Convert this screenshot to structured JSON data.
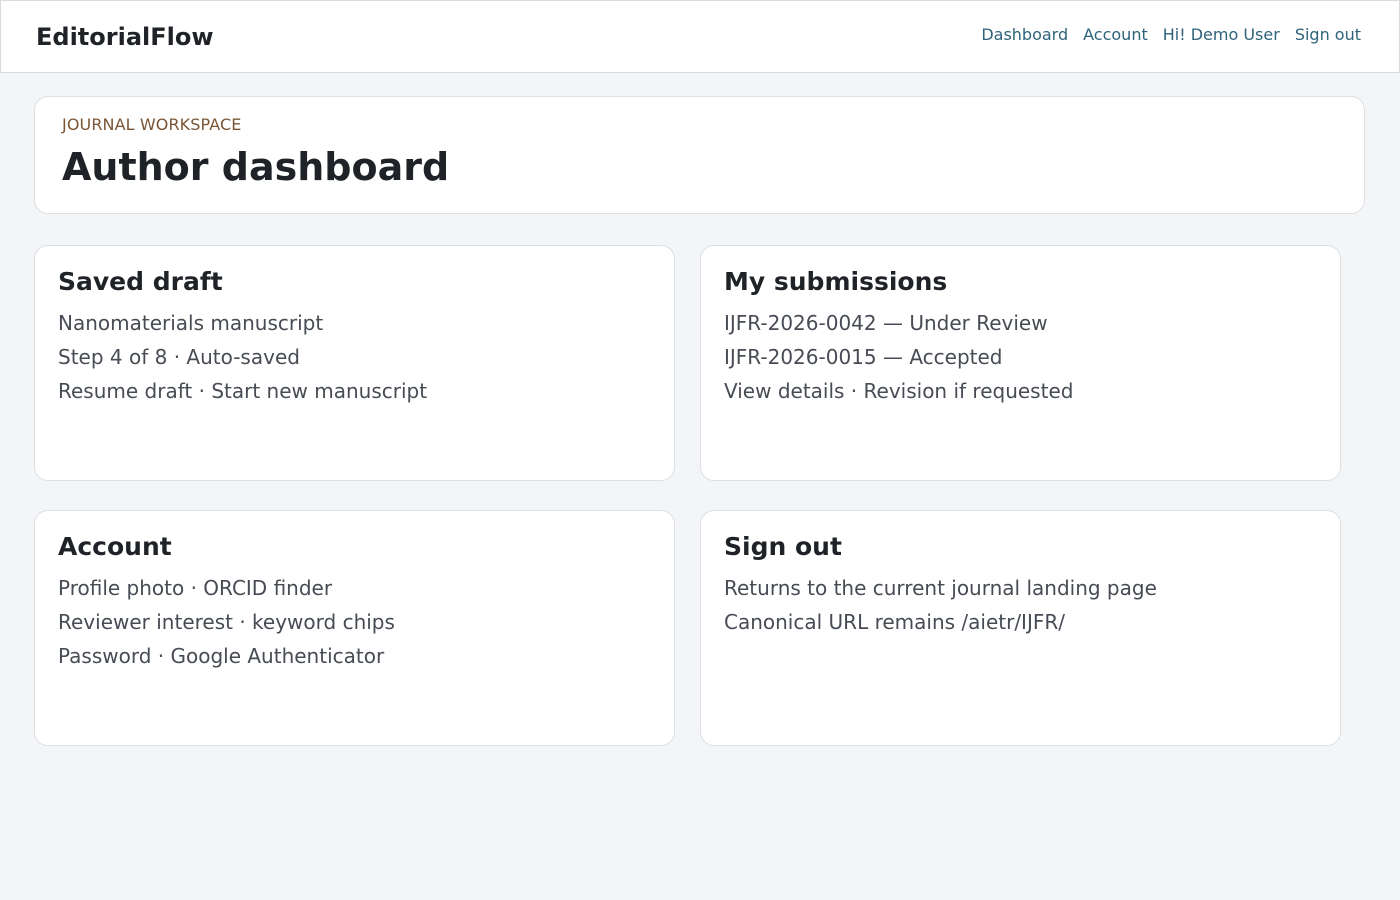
{
  "brand": "EditorialFlow",
  "nav": {
    "dashboard": "Dashboard",
    "account": "Account",
    "greeting": "Hi! Demo User",
    "signout": "Sign out"
  },
  "hero": {
    "eyebrow": "JOURNAL WORKSPACE",
    "title": "Author dashboard"
  },
  "cards": {
    "draft": {
      "title": "Saved draft",
      "lines": [
        "Nanomaterials manuscript",
        "Step 4 of 8 · Auto-saved",
        "Resume draft · Start new manuscript"
      ]
    },
    "submissions": {
      "title": "My submissions",
      "lines": [
        "IJFR-2026-0042 — Under Review",
        "IJFR-2026-0015 — Accepted",
        "View details · Revision if requested"
      ]
    },
    "account": {
      "title": "Account",
      "lines": [
        "Profile photo · ORCID finder",
        "Reviewer interest · keyword chips",
        "Password · Google Authenticator"
      ]
    },
    "signout": {
      "title": "Sign out",
      "lines": [
        "Returns to the current journal landing page",
        "Canonical URL remains /aietr/IJFR/"
      ]
    }
  },
  "colors": {
    "background": "#f4f5f7",
    "link": "#2e6379",
    "eyebrow": "#7a5535"
  }
}
